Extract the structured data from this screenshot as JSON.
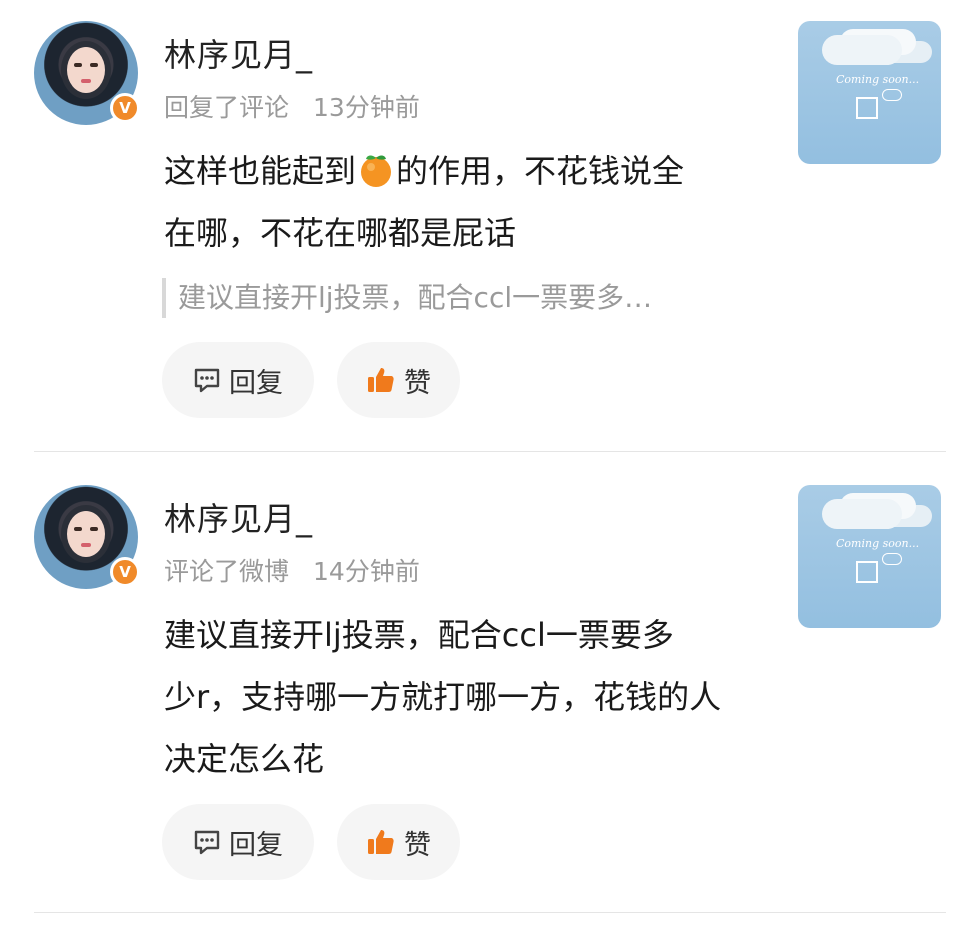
{
  "comments": [
    {
      "username": "林序见月_",
      "action": "回复了评论",
      "time": "13分钟前",
      "content_before_emoji": "这样也能起到",
      "emoji_name": "orange-emoji",
      "content_after_emoji": "的作用，不花钱说全",
      "content_line2": "在哪，不花在哪都是屁话",
      "quote": "建议直接开lj投票，配合ccl一票要多…",
      "reply_label": "回复",
      "like_label": "赞"
    },
    {
      "username": "林序见月_",
      "action": "评论了微博",
      "time": "14分钟前",
      "content_lines": [
        "建议直接开lj投票，配合ccl一票要多",
        "少r，支持哪一方就打哪一方，花钱的人",
        "决定怎么花"
      ],
      "reply_label": "回复",
      "like_label": "赞"
    }
  ],
  "thumbnail": {
    "caption": "Coming soon..."
  },
  "colors": {
    "accent_orange": "#f08a2a",
    "like_icon": "#f07a1c",
    "meta_gray": "#9a9a9a",
    "button_bg": "#f5f5f5"
  },
  "icons": {
    "reply": "comment-bubble-icon",
    "like": "thumbs-up-icon",
    "verified": "verified-v-badge-icon"
  }
}
